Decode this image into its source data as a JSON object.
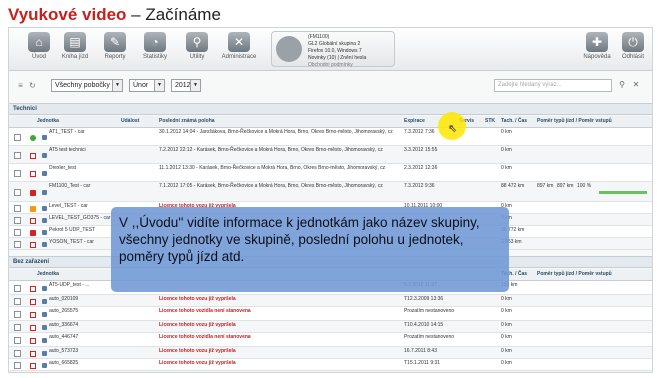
{
  "title": {
    "main": "Vyukové video",
    "sep": " – ",
    "sub": "Začínáme"
  },
  "toolbar": {
    "items": [
      {
        "label": "Úvod",
        "icon": "home-icon"
      },
      {
        "label": "Kniha jízd",
        "icon": "book-icon"
      },
      {
        "label": "Reporty",
        "icon": "report-icon"
      },
      {
        "label": "Statistiky",
        "icon": "statistics-icon"
      },
      {
        "label": "Utility",
        "icon": "search-icon"
      },
      {
        "label": "Administrace",
        "icon": "tools-icon"
      }
    ],
    "user": {
      "line1": "(FM1100)",
      "line2": "GL2 Globální skupina 2",
      "line3": "Firefox 10.0, Windows 7",
      "line4": "Novinky (10) | Znění hesla",
      "line5": "Obchodní podmínky"
    },
    "right_items": [
      {
        "label": "Nápověda",
        "icon": "help-icon"
      },
      {
        "label": "Odhlásit",
        "icon": "logout-icon"
      }
    ]
  },
  "filters": {
    "branch": "Všechny pobočky",
    "month": "Únor",
    "year": "2012",
    "search_placeholder": "Zadejte hledaný výraz..."
  },
  "groups": {
    "technici": "Technici",
    "bez_zarazeni": "Bez zařazení"
  },
  "columns": {
    "jednotka": "Jednotka",
    "udalost": "Událost",
    "posledni": "Poslední známá poloha",
    "expirace": "Expirace",
    "servis": "Servis",
    "stk": "STK",
    "tach": "Tach. / Čas",
    "pomer": "Poměr typů jízd / Poměr vstupů"
  },
  "technici_rows": [
    {
      "status": "green",
      "name": "AT1_TEST - car",
      "position": "30.1.2012 14:04 - Jarošákova, Brno-Řečkovice a Mokrá Hora, Brno, Okres Brno-město, Jihomoravský, cz",
      "expirace": "7.3.2012 7:36",
      "tach": "0 km",
      "p1": "",
      "p2": "",
      "p3": ""
    },
    {
      "status": "open",
      "name": "AT5 test technici",
      "position": "7.2.2012 22:12 - Karásek, Brno-Řečkovice a Mokrá Hora, Brno, Okres Brno-město, Jihomoravský, cz",
      "expirace": "3.3.2012 15:55",
      "tach": "0 km",
      "p1": "",
      "p2": "",
      "p3": ""
    },
    {
      "status": "open",
      "name": "Drexler_test",
      "position": "11.1.2012 13:30 - Karásek, Brno-Řečkovice a Mokrá Hora, Brno, Okres Brno-město, Jihomoravský, cz",
      "expirace": "2.3.2012 12:36",
      "tach": "0 km",
      "p1": "",
      "p2": "",
      "p3": ""
    },
    {
      "status": "red",
      "name": "FM1100_Test - car",
      "position": "7.1.2012 17:05 - Karásek, Brno-Řečkovice a Mokrá Hora, Brno, Okres Brno-město, Jihomoravský, cz",
      "expirace": "7.3.2012 9:36",
      "tach": "88 472 km",
      "p1": "897 km",
      "p2": "897 km",
      "p3": "100 %"
    },
    {
      "status": "orange",
      "name": "Level_TEST - car",
      "position": "Licence tohoto vozu již vypršela",
      "expirace": "10.11.2011 10:00",
      "tach": "0 km",
      "red": true,
      "p1": "",
      "p2": "",
      "p3": ""
    },
    {
      "status": "open",
      "name": "LEVEL_TEST_GO375 - car",
      "position": "",
      "expirace": "",
      "tach": "0 km",
      "p1": "",
      "p2": "",
      "p3": ""
    },
    {
      "status": "red",
      "name": "Pekrot 5 UDP_TEST",
      "position": "",
      "expirace": "",
      "tach": "36 772 km",
      "p1": "",
      "p2": "",
      "p3": ""
    },
    {
      "status": "open",
      "name": "YOSON_TEST - car",
      "position": "",
      "expirace": "",
      "tach": "2 053 km",
      "p1": "",
      "p2": "",
      "p3": ""
    }
  ],
  "bez_rows": [
    {
      "status": "open",
      "name": "AT5-UDP_test - ...",
      "position": "",
      "expirace": "5.2.2012 11:37",
      "tach": "153 km"
    },
    {
      "status": "open",
      "name": "auto_020109",
      "position": "Licence tohoto vozu již vypršela",
      "expirace": "T12.3.2009 13:36",
      "tach": "0 km",
      "red": true
    },
    {
      "status": "open",
      "name": "auto_265575",
      "position": "Licence tohoto vozidla není stanovena",
      "expirace": "Prozatím nestanoveno",
      "tach": "0 km",
      "red": true
    },
    {
      "status": "open",
      "name": "auto_336674",
      "position": "Licence tohoto vozu již vypršela",
      "expirace": "T10.4.2010 14:15",
      "tach": "0 km",
      "red": true
    },
    {
      "status": "open",
      "name": "auto_446747",
      "position": "Licence tohoto vozidla není stanovena",
      "expirace": "Prozatím nestanoveno",
      "tach": "0 km",
      "red": true
    },
    {
      "status": "open",
      "name": "auto_573723",
      "position": "Licence tohoto vozu již vypršela",
      "expirace": "16.7.2011 8:43",
      "tach": "0 km",
      "red": true
    },
    {
      "status": "open",
      "name": "auto_665825",
      "position": "Licence tohoto vozu již vypršela",
      "expirace": "T15.1.2011 9:31",
      "tach": "0 km",
      "red": true
    }
  ],
  "overlay": {
    "text": "V ,,Úvodu'' vidíte informace k jednotkám jako název skupiny, všechny jednotky ve skupině, poslední polohu u jednotek, poměry typů jízd atd."
  },
  "colors": {
    "brand": "#c8201c",
    "overlay": "#7098d6",
    "status_green": "#3aa935",
    "status_red": "#d42222",
    "status_orange": "#f39a12"
  }
}
